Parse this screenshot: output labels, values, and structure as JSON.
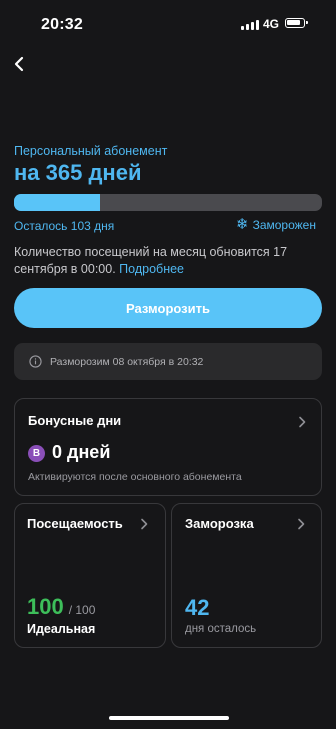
{
  "status_bar": {
    "time": "20:32",
    "network": "4G"
  },
  "subscription": {
    "subtitle": "Персональный абонемент",
    "title": "на 365 дней",
    "progress_fraction": 0.28,
    "remaining_text": "Осталось 103 дня",
    "frozen_label": "Заморожен",
    "info_text": "Количество посещений на месяц обновится 17 сентября в 00:00.",
    "info_link": "Подробнее",
    "unfreeze_button": "Разморозить",
    "notice_text": "Разморозим 08 октября в 20:32"
  },
  "bonus_days": {
    "title": "Бонусные дни",
    "badge_letter": "B",
    "value": "0 дней",
    "description": "Активируются после основного абонемента"
  },
  "attendance": {
    "title": "Посещаемость",
    "value": "100",
    "total": "/ 100",
    "label": "Идеальная"
  },
  "freeze": {
    "title": "Заморозка",
    "value": "42",
    "label": "дня осталось"
  },
  "colors": {
    "accent": "#4FB7F0",
    "button": "#59C4F8",
    "green": "#3DBE5A",
    "badge": "#8A4FB8",
    "background": "#161618"
  }
}
